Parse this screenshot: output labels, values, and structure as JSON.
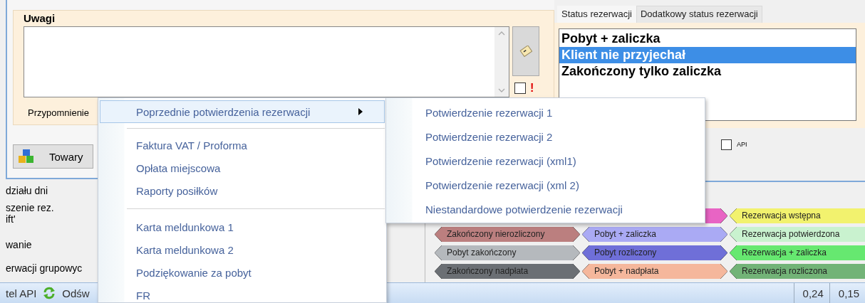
{
  "notes_group": {
    "title": "Uwagi",
    "reminder_label": "Przypomnienie",
    "reminder_checked": false,
    "alert_mark": "!"
  },
  "towary_button": {
    "label": "Towary"
  },
  "status_tabs": [
    {
      "label": "Status rezerwacji",
      "selected": true
    },
    {
      "label": "Dodatkowy status rezerwacji",
      "selected": false
    }
  ],
  "status_list": [
    {
      "label": "Pobyt + zaliczka",
      "selected": false
    },
    {
      "label": "Klient nie przyjechał",
      "selected": true
    },
    {
      "label": "Zakończony tylko zaliczka",
      "selected": false
    }
  ],
  "api_checkbox": {
    "label": "API",
    "checked": false
  },
  "side_labels": [
    "działu dni",
    "szenie rez.",
    "ift'",
    "wanie",
    "erwacji grupowyc"
  ],
  "legend_rows": [
    {
      "tags": [
        {
          "color": "#e864c4"
        },
        {
          "label": "Rezerwacja wstępna",
          "color": "#f2f26e"
        }
      ]
    },
    {
      "tags": [
        {
          "label": "Zakończony nierozliczony",
          "color": "#bb7f7f"
        },
        {
          "label": "Pobyt + zaliczka",
          "color": "#aaaaf4"
        },
        {
          "label": "Rezerwacja potwierdzona",
          "color": "#c9f2cf"
        }
      ]
    },
    {
      "tags": [
        {
          "label": "Pobyt zakończony",
          "color": "#b5b9bd"
        },
        {
          "label": "Pobyt rozliczony",
          "color": "#6f6fd8"
        },
        {
          "label": "Rezerwacja + zaliczka",
          "color": "#66e870"
        }
      ]
    },
    {
      "tags": [
        {
          "label": "Zakończony nadpłata",
          "color": "#6b6f74"
        },
        {
          "label": "Pobyt + nadpłata",
          "color": "#f5b79c"
        },
        {
          "label": "Rezerwacja rozliczona",
          "color": "#72b377"
        }
      ]
    }
  ],
  "status_bar": {
    "left_text": "tel API",
    "refresh_text": "Odśw",
    "cells": [
      "0,24",
      "0,15"
    ]
  },
  "context_menu": {
    "items": [
      {
        "kind": "submenu",
        "label": "Poprzednie potwierdzenia rezerwacji",
        "selected": true
      },
      {
        "kind": "separator"
      },
      {
        "kind": "item",
        "label": "Faktura VAT / Proforma",
        "selected": false
      },
      {
        "kind": "item",
        "label": "Opłata miejscowa",
        "selected": false
      },
      {
        "kind": "item",
        "label": "Raporty posiłków",
        "selected": false
      },
      {
        "kind": "separator"
      },
      {
        "kind": "item",
        "label": "Karta meldunkowa 1",
        "selected": false
      },
      {
        "kind": "item",
        "label": "Karta meldunkowa 2",
        "selected": false
      },
      {
        "kind": "item",
        "label": "Podziękowanie za pobyt",
        "selected": false
      },
      {
        "kind": "item",
        "label": "FR",
        "selected": false
      }
    ]
  },
  "submenu": {
    "items": [
      {
        "label": "Potwierdzenie rezerwacji 1",
        "selected": false
      },
      {
        "label": "Potwierdzenie rezerwacji 2",
        "selected": false
      },
      {
        "label": "Potwierdzenie rezerwacji (xml1)",
        "selected": false
      },
      {
        "label": "Potwierdzenie rezerwacji (xml 2)",
        "selected": false
      },
      {
        "label": "Niestandardowe potwierdzenie rezerwacji",
        "selected": false
      }
    ]
  }
}
